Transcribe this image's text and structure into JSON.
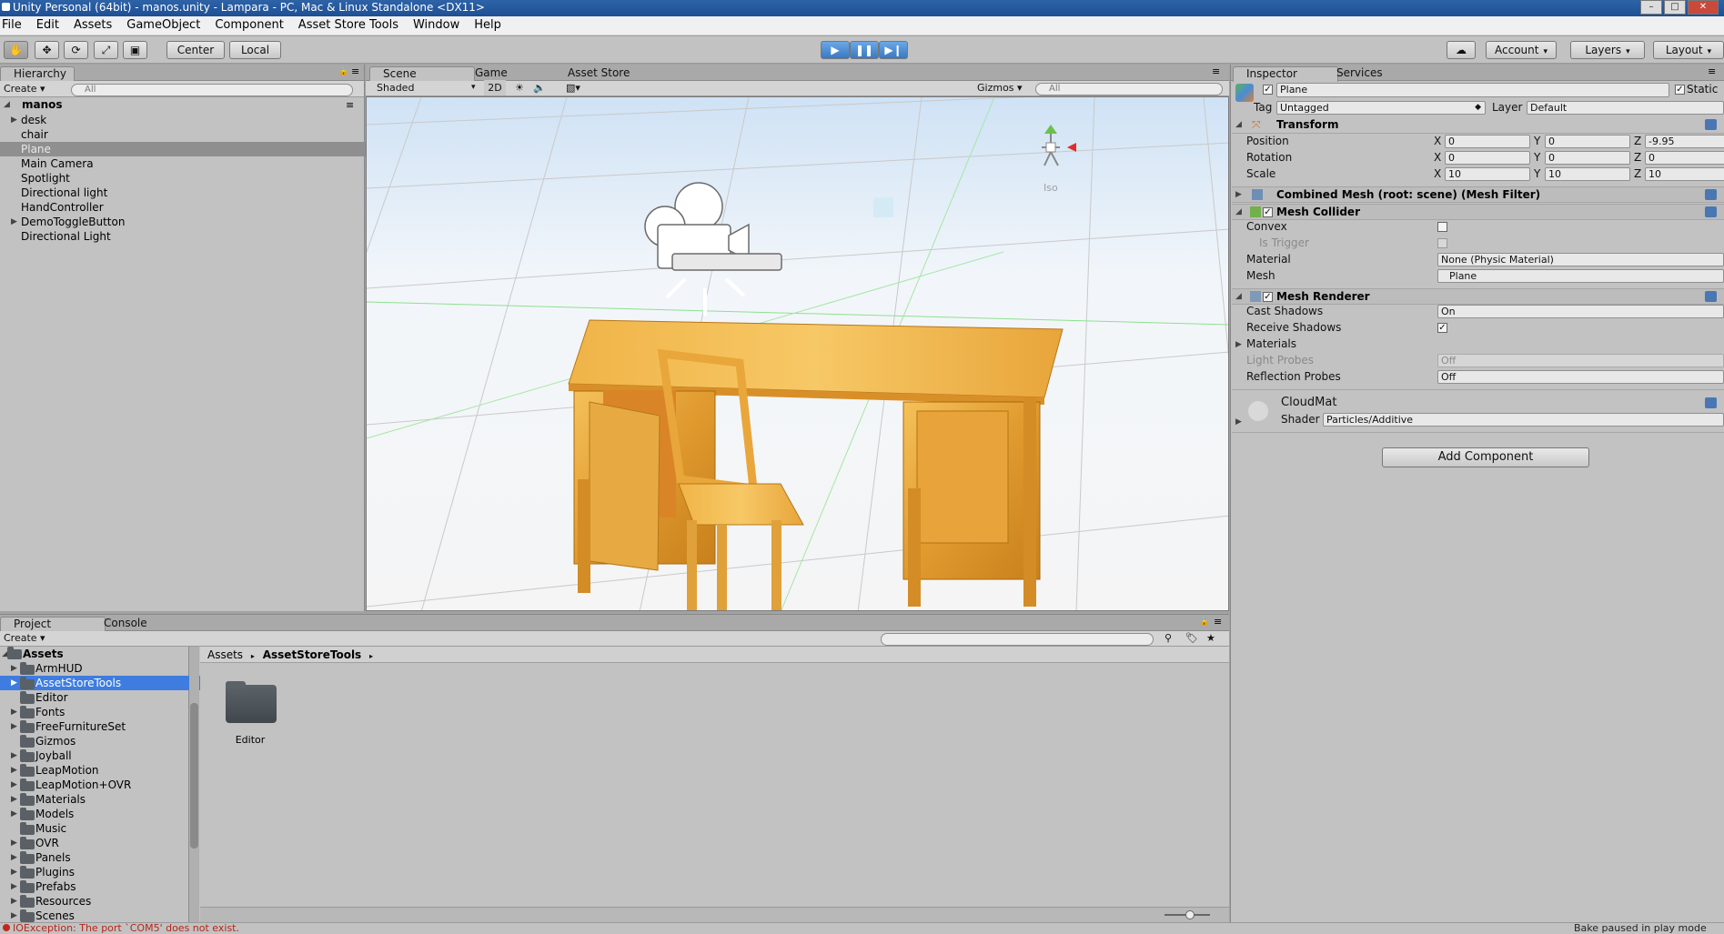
{
  "window": {
    "title": "Unity Personal (64bit) - manos.unity - Lampara - PC, Mac & Linux Standalone <DX11>"
  },
  "menu": [
    "File",
    "Edit",
    "Assets",
    "GameObject",
    "Component",
    "Asset Store Tools",
    "Window",
    "Help"
  ],
  "toolbar": {
    "tools": [
      "hand-tool-icon",
      "move-tool-icon",
      "rotate-tool-icon",
      "scale-tool-icon",
      "rect-tool-icon"
    ],
    "pivot": "Center",
    "space": "Local",
    "account": "Account",
    "layers": "Layers",
    "layout": "Layout"
  },
  "hierarchy": {
    "tab": "Hierarchy",
    "create": "Create",
    "search_placeholder": "All",
    "scene": "manos",
    "items": [
      {
        "label": "desk",
        "expandable": true,
        "selected": false
      },
      {
        "label": "chair",
        "expandable": false,
        "selected": false
      },
      {
        "label": "Plane",
        "expandable": false,
        "selected": true
      },
      {
        "label": "Main Camera",
        "expandable": false,
        "selected": false
      },
      {
        "label": "Spotlight",
        "expandable": false,
        "selected": false
      },
      {
        "label": "Directional light",
        "expandable": false,
        "selected": false
      },
      {
        "label": "HandController",
        "expandable": false,
        "selected": false
      },
      {
        "label": "DemoToggleButton",
        "expandable": true,
        "selected": false
      },
      {
        "label": "Directional Light",
        "expandable": false,
        "selected": false
      }
    ]
  },
  "scene_view": {
    "tabs": [
      "Scene",
      "Game",
      "Asset Store"
    ],
    "shading": "Shaded",
    "mode_2d": "2D",
    "gizmos": "Gizmos",
    "search_placeholder": "All",
    "projection": "Iso"
  },
  "inspector": {
    "tabs": [
      "Inspector",
      "Services"
    ],
    "object_name": "Plane",
    "static_label": "Static",
    "tag_label": "Tag",
    "tag_value": "Untagged",
    "layer_label": "Layer",
    "layer_value": "Default",
    "transform": {
      "title": "Transform",
      "position": {
        "label": "Position",
        "x": "0",
        "y": "0",
        "z": "-9.95"
      },
      "rotation": {
        "label": "Rotation",
        "x": "0",
        "y": "0",
        "z": "0"
      },
      "scale": {
        "label": "Scale",
        "x": "10",
        "y": "10",
        "z": "10"
      }
    },
    "mesh_filter": {
      "title": "Combined Mesh (root: scene) (Mesh Filter)"
    },
    "mesh_collider": {
      "title": "Mesh Collider",
      "convex": "Convex",
      "is_trigger": "Is Trigger",
      "material_label": "Material",
      "material_value": "None (Physic Material)",
      "mesh_label": "Mesh",
      "mesh_value": "Plane"
    },
    "mesh_renderer": {
      "title": "Mesh Renderer",
      "cast_shadows_label": "Cast Shadows",
      "cast_shadows_value": "On",
      "receive_shadows_label": "Receive Shadows",
      "materials_label": "Materials",
      "light_probes_label": "Light Probes",
      "light_probes_value": "Off",
      "reflection_probes_label": "Reflection Probes",
      "reflection_probes_value": "Off"
    },
    "material": {
      "name": "CloudMat",
      "shader_label": "Shader",
      "shader_value": "Particles/Additive"
    },
    "add_component": "Add Component",
    "axis_labels": {
      "x": "X",
      "y": "Y",
      "z": "Z"
    }
  },
  "project": {
    "tabs": [
      "Project",
      "Console"
    ],
    "create": "Create",
    "root": "Assets",
    "folders": [
      {
        "label": "ArmHUD",
        "expandable": true,
        "selected": false
      },
      {
        "label": "AssetStoreTools",
        "expandable": true,
        "selected": true
      },
      {
        "label": "Editor",
        "expandable": false,
        "selected": false
      },
      {
        "label": "Fonts",
        "expandable": true,
        "selected": false
      },
      {
        "label": "FreeFurnitureSet",
        "expandable": true,
        "selected": false
      },
      {
        "label": "Gizmos",
        "expandable": false,
        "selected": false
      },
      {
        "label": "Joyball",
        "expandable": true,
        "selected": false
      },
      {
        "label": "LeapMotion",
        "expandable": true,
        "selected": false
      },
      {
        "label": "LeapMotion+OVR",
        "expandable": true,
        "selected": false
      },
      {
        "label": "Materials",
        "expandable": true,
        "selected": false
      },
      {
        "label": "Models",
        "expandable": true,
        "selected": false
      },
      {
        "label": "Music",
        "expandable": false,
        "selected": false
      },
      {
        "label": "OVR",
        "expandable": true,
        "selected": false
      },
      {
        "label": "Panels",
        "expandable": true,
        "selected": false
      },
      {
        "label": "Plugins",
        "expandable": true,
        "selected": false
      },
      {
        "label": "Prefabs",
        "expandable": true,
        "selected": false
      },
      {
        "label": "Resources",
        "expandable": true,
        "selected": false
      },
      {
        "label": "Scenes",
        "expandable": true,
        "selected": false
      }
    ],
    "breadcrumb": [
      "Assets",
      "AssetStoreTools"
    ],
    "content_items": [
      "Editor"
    ]
  },
  "status": {
    "error": "IOException: The port `COM5' does not exist.",
    "bake": "Bake paused in play mode"
  },
  "colors": {
    "selection": "#3e7ce0",
    "playmode": "#4a8ad6",
    "panel": "#c2c2c2"
  }
}
